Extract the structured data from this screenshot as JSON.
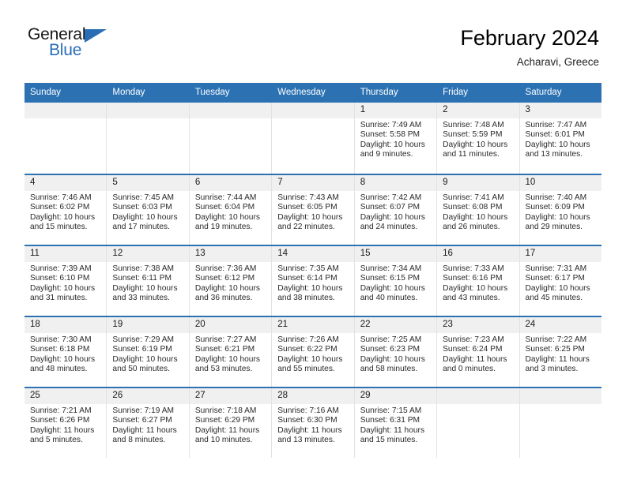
{
  "brand": {
    "name_top": "General",
    "name_bottom": "Blue",
    "triangle_color": "#2a6db5"
  },
  "header": {
    "title": "February 2024",
    "subtitle": "Acharavi, Greece",
    "accent_color": "#2c72b3",
    "day_band_color": "#f0f0f0"
  },
  "weekdays": [
    "Sunday",
    "Monday",
    "Tuesday",
    "Wednesday",
    "Thursday",
    "Friday",
    "Saturday"
  ],
  "labels": {
    "sunrise": "Sunrise:",
    "sunset": "Sunset:",
    "daylight": "Daylight:"
  },
  "weeks": [
    [
      {
        "day": "",
        "sunrise": "",
        "sunset": "",
        "daylight_line1": "",
        "daylight_line2": ""
      },
      {
        "day": "",
        "sunrise": "",
        "sunset": "",
        "daylight_line1": "",
        "daylight_line2": ""
      },
      {
        "day": "",
        "sunrise": "",
        "sunset": "",
        "daylight_line1": "",
        "daylight_line2": ""
      },
      {
        "day": "",
        "sunrise": "",
        "sunset": "",
        "daylight_line1": "",
        "daylight_line2": ""
      },
      {
        "day": "1",
        "sunrise": "Sunrise: 7:49 AM",
        "sunset": "Sunset: 5:58 PM",
        "daylight_line1": "Daylight: 10 hours",
        "daylight_line2": "and 9 minutes."
      },
      {
        "day": "2",
        "sunrise": "Sunrise: 7:48 AM",
        "sunset": "Sunset: 5:59 PM",
        "daylight_line1": "Daylight: 10 hours",
        "daylight_line2": "and 11 minutes."
      },
      {
        "day": "3",
        "sunrise": "Sunrise: 7:47 AM",
        "sunset": "Sunset: 6:01 PM",
        "daylight_line1": "Daylight: 10 hours",
        "daylight_line2": "and 13 minutes."
      }
    ],
    [
      {
        "day": "4",
        "sunrise": "Sunrise: 7:46 AM",
        "sunset": "Sunset: 6:02 PM",
        "daylight_line1": "Daylight: 10 hours",
        "daylight_line2": "and 15 minutes."
      },
      {
        "day": "5",
        "sunrise": "Sunrise: 7:45 AM",
        "sunset": "Sunset: 6:03 PM",
        "daylight_line1": "Daylight: 10 hours",
        "daylight_line2": "and 17 minutes."
      },
      {
        "day": "6",
        "sunrise": "Sunrise: 7:44 AM",
        "sunset": "Sunset: 6:04 PM",
        "daylight_line1": "Daylight: 10 hours",
        "daylight_line2": "and 19 minutes."
      },
      {
        "day": "7",
        "sunrise": "Sunrise: 7:43 AM",
        "sunset": "Sunset: 6:05 PM",
        "daylight_line1": "Daylight: 10 hours",
        "daylight_line2": "and 22 minutes."
      },
      {
        "day": "8",
        "sunrise": "Sunrise: 7:42 AM",
        "sunset": "Sunset: 6:07 PM",
        "daylight_line1": "Daylight: 10 hours",
        "daylight_line2": "and 24 minutes."
      },
      {
        "day": "9",
        "sunrise": "Sunrise: 7:41 AM",
        "sunset": "Sunset: 6:08 PM",
        "daylight_line1": "Daylight: 10 hours",
        "daylight_line2": "and 26 minutes."
      },
      {
        "day": "10",
        "sunrise": "Sunrise: 7:40 AM",
        "sunset": "Sunset: 6:09 PM",
        "daylight_line1": "Daylight: 10 hours",
        "daylight_line2": "and 29 minutes."
      }
    ],
    [
      {
        "day": "11",
        "sunrise": "Sunrise: 7:39 AM",
        "sunset": "Sunset: 6:10 PM",
        "daylight_line1": "Daylight: 10 hours",
        "daylight_line2": "and 31 minutes."
      },
      {
        "day": "12",
        "sunrise": "Sunrise: 7:38 AM",
        "sunset": "Sunset: 6:11 PM",
        "daylight_line1": "Daylight: 10 hours",
        "daylight_line2": "and 33 minutes."
      },
      {
        "day": "13",
        "sunrise": "Sunrise: 7:36 AM",
        "sunset": "Sunset: 6:12 PM",
        "daylight_line1": "Daylight: 10 hours",
        "daylight_line2": "and 36 minutes."
      },
      {
        "day": "14",
        "sunrise": "Sunrise: 7:35 AM",
        "sunset": "Sunset: 6:14 PM",
        "daylight_line1": "Daylight: 10 hours",
        "daylight_line2": "and 38 minutes."
      },
      {
        "day": "15",
        "sunrise": "Sunrise: 7:34 AM",
        "sunset": "Sunset: 6:15 PM",
        "daylight_line1": "Daylight: 10 hours",
        "daylight_line2": "and 40 minutes."
      },
      {
        "day": "16",
        "sunrise": "Sunrise: 7:33 AM",
        "sunset": "Sunset: 6:16 PM",
        "daylight_line1": "Daylight: 10 hours",
        "daylight_line2": "and 43 minutes."
      },
      {
        "day": "17",
        "sunrise": "Sunrise: 7:31 AM",
        "sunset": "Sunset: 6:17 PM",
        "daylight_line1": "Daylight: 10 hours",
        "daylight_line2": "and 45 minutes."
      }
    ],
    [
      {
        "day": "18",
        "sunrise": "Sunrise: 7:30 AM",
        "sunset": "Sunset: 6:18 PM",
        "daylight_line1": "Daylight: 10 hours",
        "daylight_line2": "and 48 minutes."
      },
      {
        "day": "19",
        "sunrise": "Sunrise: 7:29 AM",
        "sunset": "Sunset: 6:19 PM",
        "daylight_line1": "Daylight: 10 hours",
        "daylight_line2": "and 50 minutes."
      },
      {
        "day": "20",
        "sunrise": "Sunrise: 7:27 AM",
        "sunset": "Sunset: 6:21 PM",
        "daylight_line1": "Daylight: 10 hours",
        "daylight_line2": "and 53 minutes."
      },
      {
        "day": "21",
        "sunrise": "Sunrise: 7:26 AM",
        "sunset": "Sunset: 6:22 PM",
        "daylight_line1": "Daylight: 10 hours",
        "daylight_line2": "and 55 minutes."
      },
      {
        "day": "22",
        "sunrise": "Sunrise: 7:25 AM",
        "sunset": "Sunset: 6:23 PM",
        "daylight_line1": "Daylight: 10 hours",
        "daylight_line2": "and 58 minutes."
      },
      {
        "day": "23",
        "sunrise": "Sunrise: 7:23 AM",
        "sunset": "Sunset: 6:24 PM",
        "daylight_line1": "Daylight: 11 hours",
        "daylight_line2": "and 0 minutes."
      },
      {
        "day": "24",
        "sunrise": "Sunrise: 7:22 AM",
        "sunset": "Sunset: 6:25 PM",
        "daylight_line1": "Daylight: 11 hours",
        "daylight_line2": "and 3 minutes."
      }
    ],
    [
      {
        "day": "25",
        "sunrise": "Sunrise: 7:21 AM",
        "sunset": "Sunset: 6:26 PM",
        "daylight_line1": "Daylight: 11 hours",
        "daylight_line2": "and 5 minutes."
      },
      {
        "day": "26",
        "sunrise": "Sunrise: 7:19 AM",
        "sunset": "Sunset: 6:27 PM",
        "daylight_line1": "Daylight: 11 hours",
        "daylight_line2": "and 8 minutes."
      },
      {
        "day": "27",
        "sunrise": "Sunrise: 7:18 AM",
        "sunset": "Sunset: 6:29 PM",
        "daylight_line1": "Daylight: 11 hours",
        "daylight_line2": "and 10 minutes."
      },
      {
        "day": "28",
        "sunrise": "Sunrise: 7:16 AM",
        "sunset": "Sunset: 6:30 PM",
        "daylight_line1": "Daylight: 11 hours",
        "daylight_line2": "and 13 minutes."
      },
      {
        "day": "29",
        "sunrise": "Sunrise: 7:15 AM",
        "sunset": "Sunset: 6:31 PM",
        "daylight_line1": "Daylight: 11 hours",
        "daylight_line2": "and 15 minutes."
      },
      {
        "day": "",
        "sunrise": "",
        "sunset": "",
        "daylight_line1": "",
        "daylight_line2": ""
      },
      {
        "day": "",
        "sunrise": "",
        "sunset": "",
        "daylight_line1": "",
        "daylight_line2": ""
      }
    ]
  ]
}
